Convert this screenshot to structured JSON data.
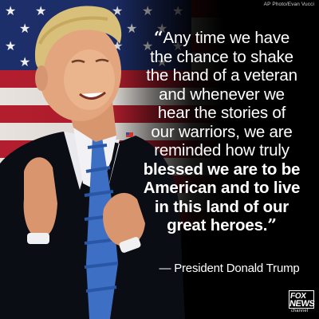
{
  "credit": "AP Photo/Evan Vucci",
  "quote": {
    "lines": [
      {
        "text": "Any time we have",
        "bold": false
      },
      {
        "text": "the chance to shake",
        "bold": false
      },
      {
        "text": "the hand of a veteran",
        "bold": false
      },
      {
        "text": "and whenever we",
        "bold": false
      },
      {
        "text": "hear the stories of",
        "bold": false
      },
      {
        "text": "our warriors, we are",
        "bold": false
      },
      {
        "text": "reminded how truly",
        "bold": false
      },
      {
        "text": "blessed we are to be",
        "bold": true
      },
      {
        "text": "American and to live",
        "bold": true
      },
      {
        "text": "in this land of our",
        "bold": true
      },
      {
        "text": "great heroes.",
        "bold": true
      }
    ],
    "open_mark": "“",
    "close_mark": "”"
  },
  "attribution": "— President Donald Trump",
  "logo": {
    "line1": "FOX",
    "line2": "NEWS",
    "line3": "channel"
  },
  "colors": {
    "background": "#000000",
    "text": "#ffffff",
    "flag_red": "#b31e2e",
    "flag_blue": "#1d2f6b",
    "tie_blue": "#3d6fc4"
  }
}
